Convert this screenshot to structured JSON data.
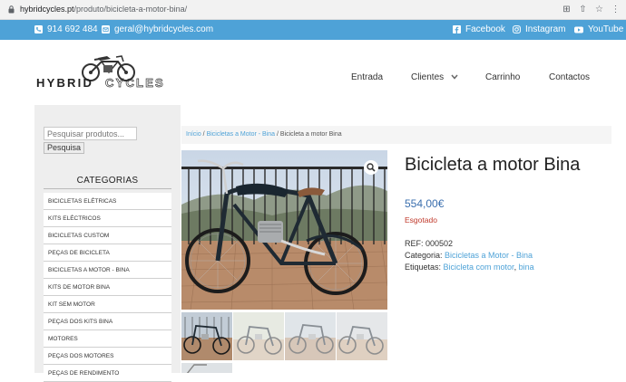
{
  "browser": {
    "url_domain": "hybridcycles.pt",
    "url_path": "/produto/bicicleta-a-motor-bina/"
  },
  "topbar": {
    "phone": "914 692 484",
    "email": "geral@hybridcycles.com",
    "facebook": "Facebook",
    "instagram": "Instagram",
    "youtube": "YouTube",
    "bg_color": "#4ea2d7"
  },
  "logo": {
    "text": "HYBRIDCYCLES"
  },
  "nav": {
    "entrada": "Entrada",
    "clientes": "Clientes",
    "carrinho": "Carrinho",
    "contactos": "Contactos"
  },
  "sidebar": {
    "search_placeholder": "Pesquisar produtos...",
    "search_button": "Pesquisa",
    "categories_title": "CATEGORIAS",
    "categories": [
      "BICICLETAS ELÉTRICAS",
      "KITS ELÉCTRICOS",
      "BICICLETAS CUSTOM",
      "PEÇAS DE BICICLETA",
      "BICICLETAS A MOTOR - BINA",
      "KITS DE MOTOR BINA",
      "KIT SEM MOTOR",
      "PEÇAS DOS KITS BINA",
      "MOTORES",
      "PEÇAS DOS MOTORES",
      "PEÇAS DE RENDIMENTO"
    ]
  },
  "breadcrumb": {
    "home": "Início",
    "sep1": " / ",
    "category": "Bicicletas a Motor - Bina",
    "sep2": " / ",
    "current": "Bicicleta a motor Bina"
  },
  "product": {
    "title": "Bicicleta a motor Bina",
    "price": "554,00€",
    "stock_status": "Esgotado",
    "ref_label": "REF: ",
    "ref": "000502",
    "category_label": "Categoria: ",
    "category": "Bicicletas a Motor - Bina",
    "tags_label": "Etiquetas: ",
    "tag1": "Bicicleta com motor",
    "tag_sep": ", ",
    "tag2": "bina"
  }
}
